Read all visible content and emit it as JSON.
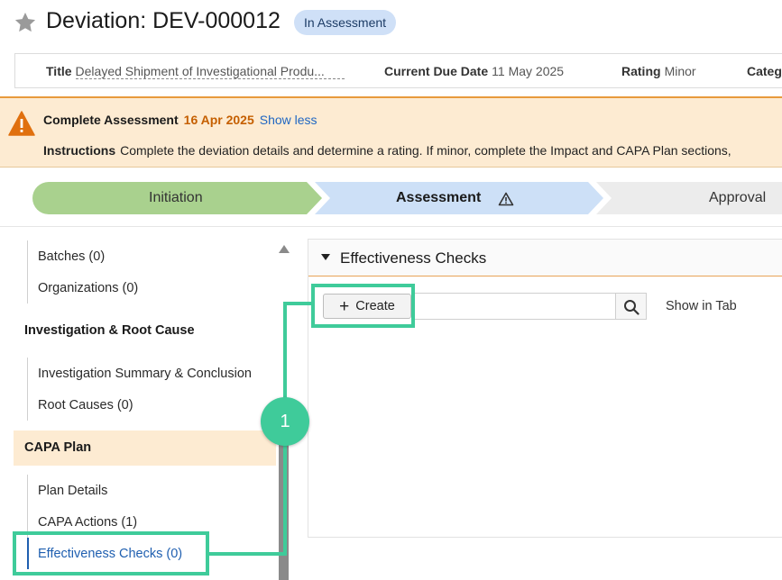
{
  "record": {
    "title": "Deviation: DEV-000012",
    "status_badge": "In Assessment"
  },
  "info": {
    "title_label": "Title",
    "title_value": "Delayed Shipment of Investigational Produ...",
    "due_label": "Current Due Date",
    "due_value": "11 May 2025",
    "rating_label": "Rating",
    "rating_value": "Minor",
    "category_label": "Categ"
  },
  "banner": {
    "task": "Complete Assessment",
    "date": "16 Apr 2025",
    "toggle": "Show less",
    "instructions_label": "Instructions",
    "instructions_text": "Complete the deviation details and determine a rating. If minor, complete the Impact and CAPA Plan sections,"
  },
  "stages": {
    "items": [
      "Initiation",
      "Assessment",
      "Approval"
    ],
    "colors": {
      "done": "#a9d18e",
      "current": "#cde0f7",
      "next": "#ececec"
    }
  },
  "sidebar": {
    "items_top": [
      "Batches (0)",
      "Organizations (0)"
    ],
    "section_investigation": "Investigation & Root Cause",
    "items_investigation": [
      "Investigation Summary & Conclusion",
      "Root Causes (0)"
    ],
    "section_capa": "CAPA Plan",
    "items_capa": [
      "Plan Details",
      "CAPA Actions (1)",
      "Effectiveness Checks (0)"
    ]
  },
  "panel": {
    "title": "Effectiveness Checks",
    "create_label": "Create",
    "search_placeholder": "",
    "show_in_tab": "Show in Tab"
  },
  "annotation": {
    "step": "1",
    "color": "#3fcb9a"
  }
}
